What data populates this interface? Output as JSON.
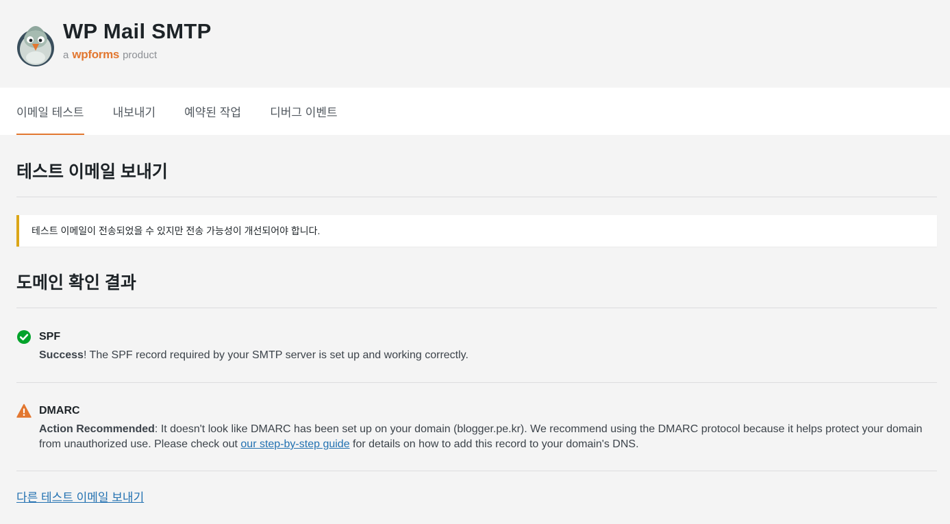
{
  "brand": {
    "title": "WP Mail SMTP",
    "sub_prefix": "a",
    "sub_brand": "wpforms",
    "sub_suffix": "product"
  },
  "tabs": [
    {
      "label": "이메일 테스트",
      "active": true
    },
    {
      "label": "내보내기",
      "active": false
    },
    {
      "label": "예약된 작업",
      "active": false
    },
    {
      "label": "디버그 이벤트",
      "active": false
    }
  ],
  "main": {
    "title": "테스트 이메일 보내기",
    "notice": "테스트 이메일이 전송되었을 수 있지만 전송 가능성이 개선되어야 합니다.",
    "domain_title": "도메인 확인 결과",
    "results": [
      {
        "name": "SPF",
        "status": "success",
        "status_label": "Success",
        "message": "! The SPF record required by your SMTP server is set up and working correctly."
      },
      {
        "name": "DMARC",
        "status": "warning",
        "status_label": "Action Recommended",
        "message_before": ": It doesn't look like DMARC has been set up on your domain (blogger.pe.kr). We recommend using the DMARC protocol because it helps protect your domain from unauthorized use. Please check out ",
        "link_text": "our step-by-step guide",
        "message_after": " for details on how to add this record to your domain's DNS."
      }
    ],
    "send_another_label": "다른 테스트 이메일 보내기"
  },
  "colors": {
    "accent": "#e27730",
    "success": "#00a32a",
    "warning": "#e27730",
    "notice_border": "#dba617",
    "link": "#2271b1"
  }
}
